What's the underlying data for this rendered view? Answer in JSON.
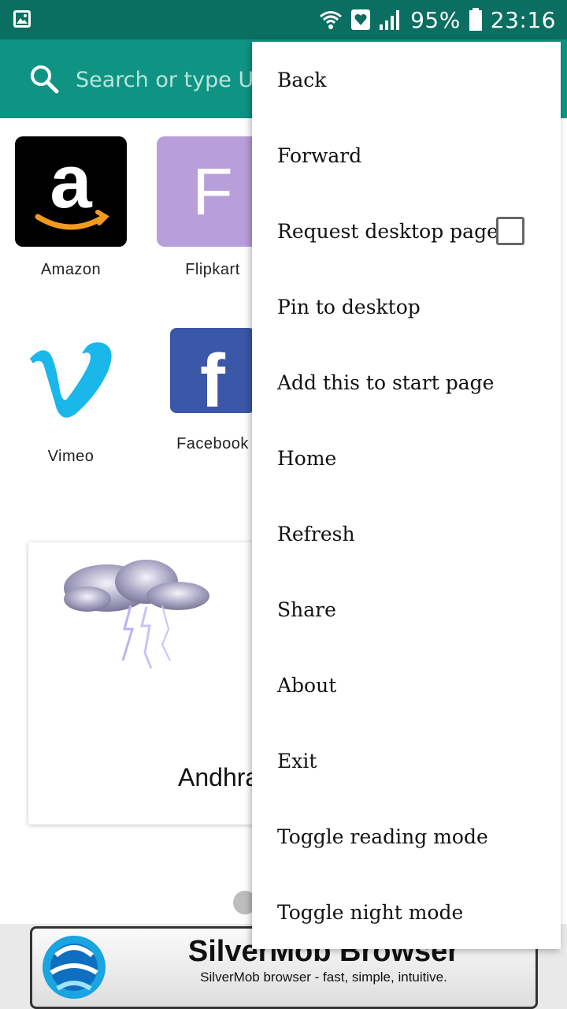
{
  "status_bar": {
    "battery": "95%",
    "time": "23:16"
  },
  "toolbar": {
    "search_placeholder": "Search or type URL"
  },
  "speed_dial": [
    {
      "label": "Amazon"
    },
    {
      "label": "Flipkart",
      "letter": "F"
    },
    {
      "label": "Vimeo"
    },
    {
      "label": "Facebook",
      "letter": "f"
    }
  ],
  "weather": {
    "place": "Andhra"
  },
  "ad": {
    "title": "SilverMob Browser",
    "subtitle": "SilverMob browser - fast, simple, intuitive."
  },
  "menu": {
    "items": [
      "Back",
      "Forward",
      "Request desktop page",
      "Pin to desktop",
      "Add this to start page",
      "Home",
      "Refresh",
      "Share",
      "About",
      "Exit",
      "Toggle reading mode",
      "Toggle night mode"
    ],
    "request_desktop_checked": false
  },
  "colors": {
    "status_bar": "#0a6e61",
    "toolbar": "#0f9483",
    "amazon_orange": "#f29a1d",
    "vimeo_blue": "#1ab7ea",
    "facebook_blue": "#3b57a7",
    "flipkart_purple": "#b89fdb"
  }
}
